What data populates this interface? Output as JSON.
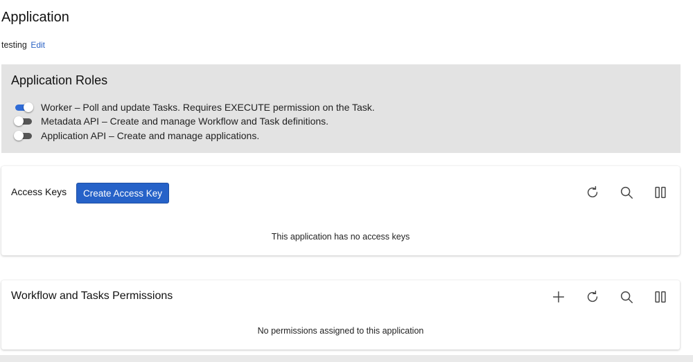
{
  "page": {
    "title": "Application",
    "name": "testing",
    "edit_label": "Edit"
  },
  "roles": {
    "title": "Application Roles",
    "items": [
      {
        "label": "Worker – Poll and update Tasks. Requires EXECUTE permission on the Task.",
        "enabled": true
      },
      {
        "label": "Metadata API – Create and manage Workflow and Task definitions.",
        "enabled": false
      },
      {
        "label": "Application API – Create and manage applications.",
        "enabled": false
      }
    ]
  },
  "access_keys": {
    "title": "Access Keys",
    "create_label": "Create Access Key",
    "empty_message": "This application has no access keys",
    "toolbar_icons": [
      "refresh-icon",
      "search-icon",
      "columns-icon"
    ]
  },
  "permissions": {
    "title": "Workflow and Tasks Permissions",
    "empty_message": "No permissions assigned to this application",
    "toolbar_icons": [
      "add-icon",
      "refresh-icon",
      "search-icon",
      "columns-icon"
    ]
  },
  "colors": {
    "accent": "#2662c8",
    "toggle_on": "#2f6bd6",
    "panel_bg": "#e3e3e3"
  }
}
